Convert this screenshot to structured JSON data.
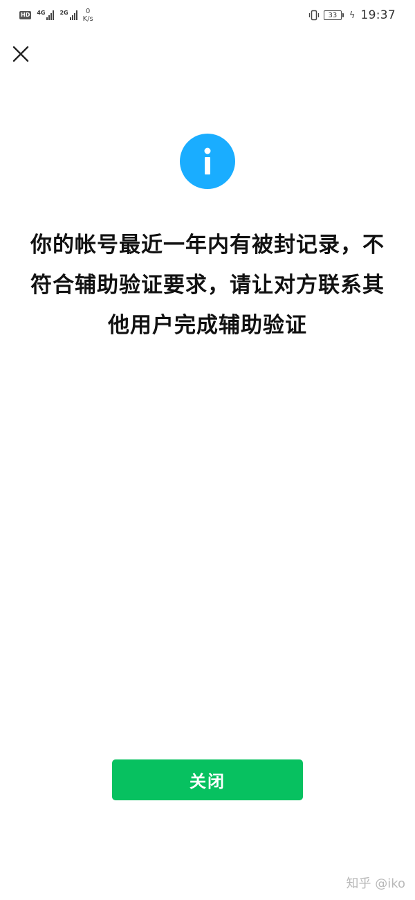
{
  "status_bar": {
    "hd_badge": "HD",
    "network_1": "4G",
    "network_2": "2G",
    "speed_value": "0",
    "speed_unit": "K/s",
    "battery": "33",
    "time": "19:37"
  },
  "dialog": {
    "message": "你的帐号最近一年内有被封记录，不符合辅助验证要求，请让对方联系其他用户完成辅助验证",
    "close_button_label": "关闭"
  },
  "watermark": {
    "text": "知乎 @iko"
  },
  "colors": {
    "info_blue": "#1aadff",
    "primary_green": "#07c160"
  },
  "icons": {
    "close": "close-icon",
    "info": "info-icon"
  }
}
